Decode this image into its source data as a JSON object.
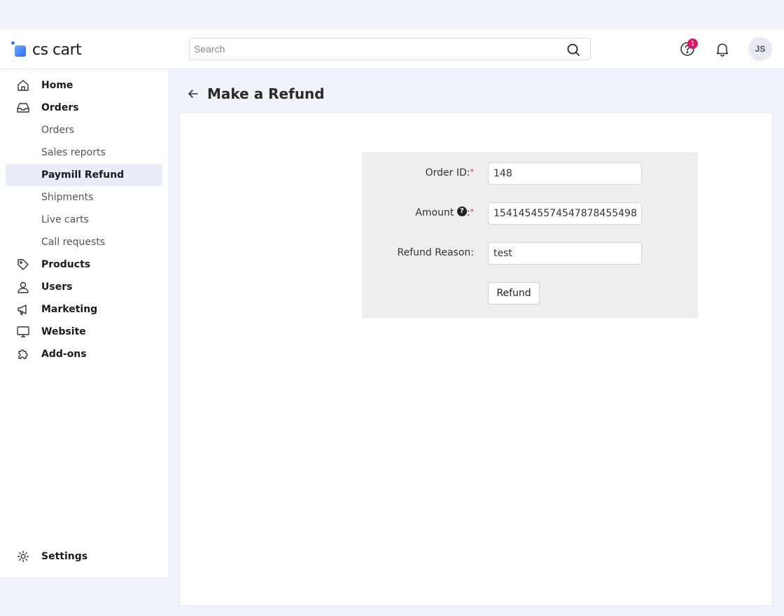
{
  "app": {
    "logo_text": "cs cart"
  },
  "header": {
    "search_placeholder": "Search",
    "help_badge_count": "1",
    "avatar_initials": "JS"
  },
  "sidebar": {
    "items": [
      {
        "label": "Home",
        "icon": "home-icon"
      },
      {
        "label": "Orders",
        "icon": "inbox-icon"
      },
      {
        "label": "Orders",
        "sub": true
      },
      {
        "label": "Sales reports",
        "sub": true
      },
      {
        "label": "Paymill Refund",
        "sub": true,
        "active": true
      },
      {
        "label": "Shipments",
        "sub": true
      },
      {
        "label": "Live carts",
        "sub": true
      },
      {
        "label": "Call requests",
        "sub": true
      },
      {
        "label": "Products",
        "icon": "tag-icon"
      },
      {
        "label": "Users",
        "icon": "user-icon"
      },
      {
        "label": "Marketing",
        "icon": "megaphone-icon"
      },
      {
        "label": "Website",
        "icon": "monitor-icon"
      },
      {
        "label": "Add-ons",
        "icon": "puzzle-icon"
      }
    ],
    "settings_label": "Settings"
  },
  "page": {
    "title": "Make a Refund"
  },
  "form": {
    "order_id_label": "Order ID:",
    "order_id_value": "148",
    "amount_label": "Amount",
    "amount_value": "15414545574547878455498",
    "reason_label": "Refund Reason:",
    "reason_value": "test",
    "required_mark": "*",
    "submit_label": "Refund"
  },
  "colors": {
    "accent": "#2f6bff",
    "badge": "#d91863",
    "active_bg": "#e8edf7"
  }
}
